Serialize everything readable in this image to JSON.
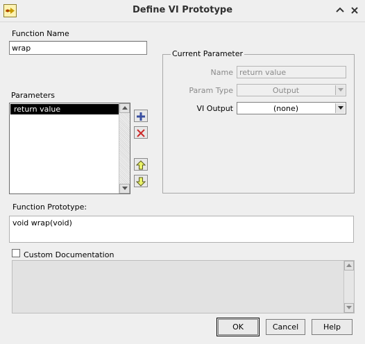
{
  "window": {
    "title": "Define VI Prototype"
  },
  "function_name": {
    "label": "Function Name",
    "value": "wrap"
  },
  "parameters": {
    "label": "Parameters",
    "items": [
      "return value"
    ]
  },
  "current_parameter": {
    "group_label": "Current Parameter",
    "name_label": "Name",
    "name_value": "return value",
    "param_type_label": "Param Type",
    "param_type_value": "Output",
    "vi_output_label": "VI Output",
    "vi_output_value": "(none)"
  },
  "prototype": {
    "label": "Function Prototype:",
    "value": "void wrap(void)"
  },
  "custom_documentation": {
    "label": "Custom Documentation",
    "checked": false
  },
  "buttons": {
    "ok": "OK",
    "cancel": "Cancel",
    "help": "Help"
  },
  "icons": {
    "add": "plus-icon",
    "remove": "x-icon",
    "up": "arrow-up-icon",
    "down": "arrow-down-icon"
  },
  "colors": {
    "add_icon": "#3a4fa0",
    "remove_icon": "#cc2b2b",
    "arrow_icon_fill": "#e9f26a",
    "selected_row": "#000000"
  }
}
